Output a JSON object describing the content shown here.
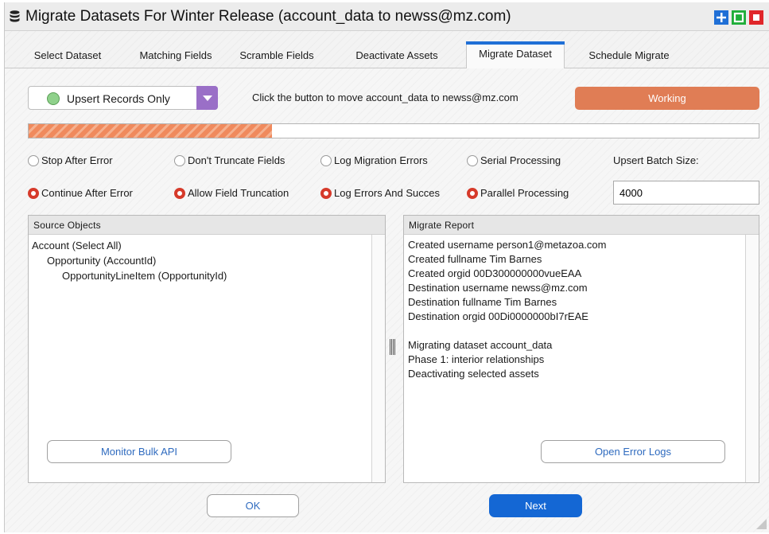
{
  "window": {
    "title": "Migrate Datasets For Winter Release (account_data to newss@mz.com)",
    "title_icon": "database-icon",
    "controls": {
      "add": "plus-icon",
      "maximize": "maximize-icon",
      "close": "close-icon"
    }
  },
  "tabs": [
    {
      "label": "Select Dataset",
      "active": false
    },
    {
      "label": "Matching Fields",
      "active": false
    },
    {
      "label": "Scramble Fields",
      "active": false
    },
    {
      "label": "Deactivate Assets",
      "active": false
    },
    {
      "label": "Migrate Dataset",
      "active": true
    },
    {
      "label": "Schedule Migrate",
      "active": false
    }
  ],
  "mode_select": {
    "value": "Upsert Records Only",
    "status_color": "#8fd18b"
  },
  "instruction": "Click the button to move account_data to newss@mz.com",
  "action_button": {
    "label": "Working",
    "color": "#e07d55"
  },
  "progress": {
    "fraction": 0.333,
    "color": "#f08a5d"
  },
  "options": {
    "row1": [
      "Stop After Error",
      "Don't Truncate Fields",
      "Log Migration Errors",
      "Serial Processing"
    ],
    "row2": [
      "Continue After Error",
      "Allow Field Truncation",
      "Log Errors And Succes",
      "Parallel Processing"
    ],
    "selected_row": 2
  },
  "batch": {
    "label": "Upsert Batch Size:",
    "value": "4000"
  },
  "source_panel": {
    "header": "Source Objects",
    "items": [
      {
        "label": "Account (Select All)",
        "level": 0
      },
      {
        "label": "Opportunity (AccountId)",
        "level": 1
      },
      {
        "label": "OpportunityLineItem (OpportunityId)",
        "level": 2
      }
    ],
    "button": "Monitor Bulk API"
  },
  "report_panel": {
    "header": "Migrate Report",
    "lines": [
      "Created username person1@metazoa.com",
      "Created fullname Tim Barnes",
      "Created orgid 00D300000000vueEAA",
      "Destination username newss@mz.com",
      "Destination fullname Tim Barnes",
      "Destination orgid 00Di0000000bI7rEAE",
      "",
      "Migrating dataset account_data",
      "Phase 1: interior relationships",
      "Deactivating selected assets"
    ],
    "button": "Open Error Logs"
  },
  "footer": {
    "ok": "OK",
    "next": "Next"
  }
}
